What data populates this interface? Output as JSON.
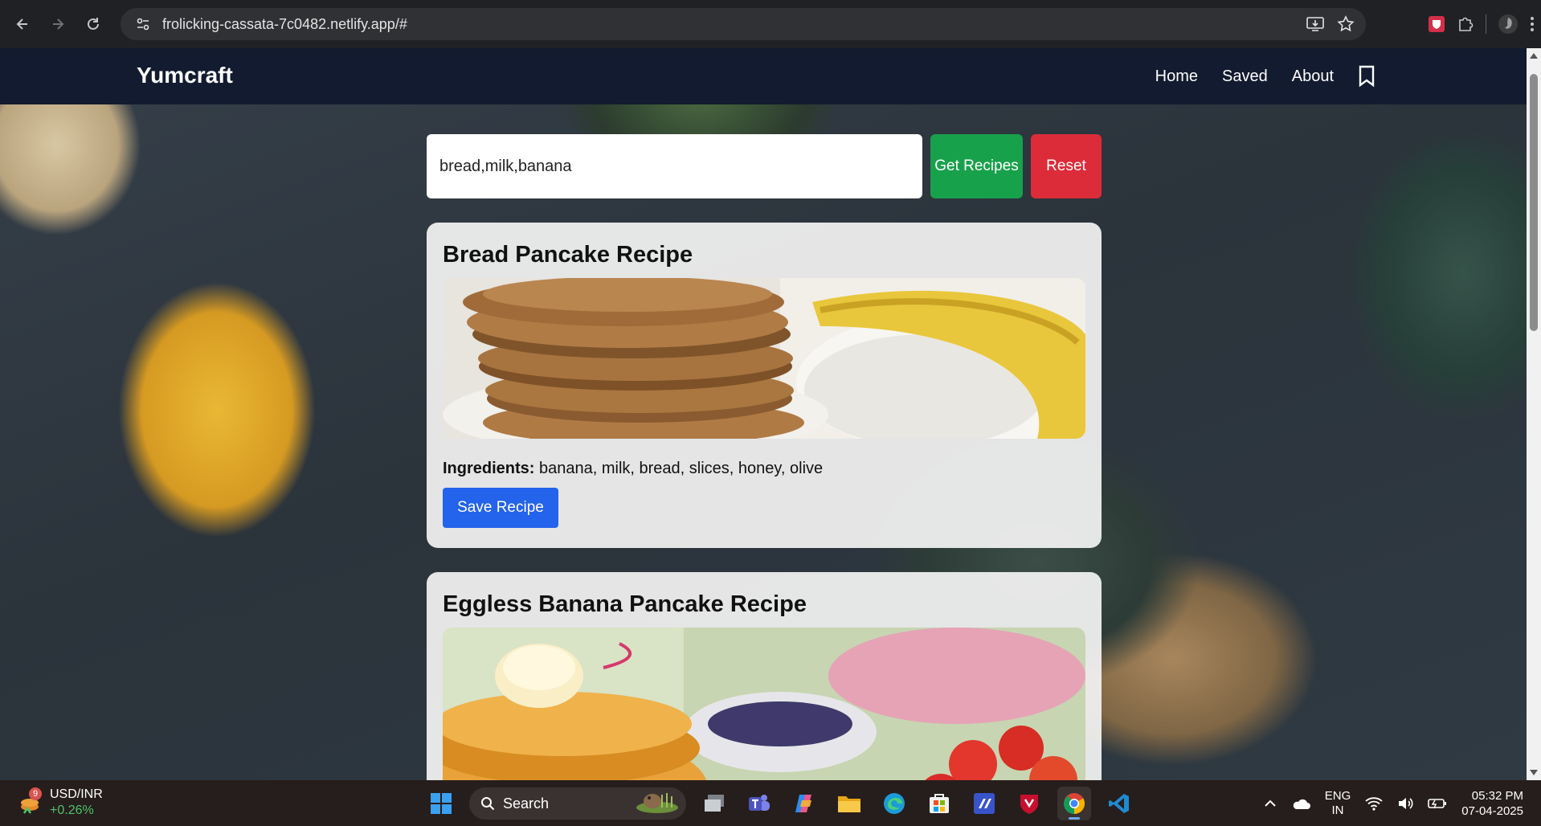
{
  "browser": {
    "url": "frolicking-cassata-7c0482.netlify.app/#"
  },
  "site": {
    "brand": "Yumcraft",
    "nav": {
      "home": "Home",
      "saved": "Saved",
      "about": "About"
    }
  },
  "search": {
    "value": "bread,milk,banana",
    "get_label": "Get Recipes",
    "reset_label": "Reset"
  },
  "recipes": [
    {
      "title": "Bread Pancake Recipe",
      "ingredients_label": "Ingredients:",
      "ingredients": "banana, milk, bread, slices, honey, olive",
      "save_label": "Save Recipe"
    },
    {
      "title": "Eggless Banana Pancake Recipe"
    }
  ],
  "taskbar": {
    "widget_badge": "9",
    "widget_title": "USD/INR",
    "widget_change": "+0.26%",
    "search_label": "Search",
    "lang_top": "ENG",
    "lang_bottom": "IN",
    "time": "05:32 PM",
    "date": "07-04-2025"
  },
  "colors": {
    "nav_bg": "#121b2f",
    "get_button": "#18a14b",
    "reset_button": "#dc2c3a",
    "save_button": "#2463eb"
  }
}
